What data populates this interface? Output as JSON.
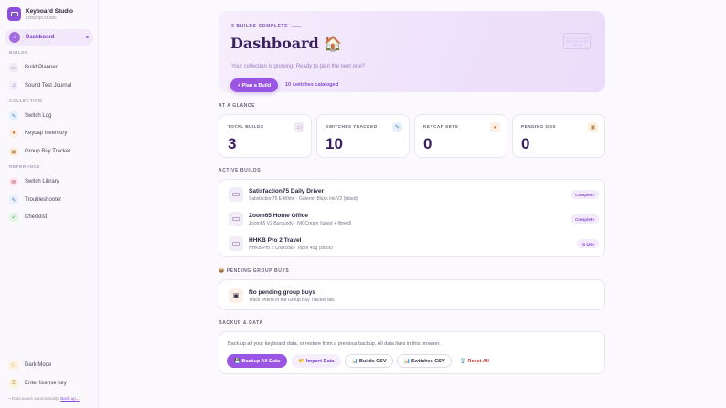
{
  "app": {
    "name": "Keyboard Studio",
    "subtitle": "ccmanpt.studio"
  },
  "sidebar": {
    "active": {
      "label": "Dashboard",
      "icon": "home-icon"
    },
    "sections": {
      "builds": "BUILDS",
      "collection": "COLLECTION",
      "reference": "REFERENCE"
    },
    "items": [
      {
        "label": "Build Planner",
        "icon": "keyboard-icon"
      },
      {
        "label": "Sound Test Journal",
        "icon": "music-icon"
      },
      {
        "label": "Switch Log",
        "icon": "wrench-icon"
      },
      {
        "label": "Keycap Inventory",
        "icon": "palette-icon"
      },
      {
        "label": "Group Buy Tracker",
        "icon": "package-icon"
      },
      {
        "label": "Switch Library",
        "icon": "book-icon"
      },
      {
        "label": "Troubleshooter",
        "icon": "wrench-icon"
      },
      {
        "label": "Checklist",
        "icon": "check-icon"
      }
    ],
    "footer": {
      "dark_mode": "Dark Mode",
      "license": "Enter license key",
      "autosave_text": "Data saves automatically.",
      "autosave_link": "Back up..."
    }
  },
  "hero": {
    "kicker": "3 BUILDS COMPLETE",
    "title": "Dashboard 🏠",
    "subtitle": "Your collection is growing. Ready to plan the next one?",
    "button": "+ Plan a Build",
    "meta": "10 switches cataloged"
  },
  "glance": {
    "heading": "AT A GLANCE",
    "stats": [
      {
        "label": "TOTAL BUILDS",
        "value": "3",
        "icon": "keyboard-icon"
      },
      {
        "label": "SWITCHES TRACKED",
        "value": "10",
        "icon": "wrench-icon"
      },
      {
        "label": "KEYCAP SETS",
        "value": "0",
        "icon": "palette-icon"
      },
      {
        "label": "PENDING GBS",
        "value": "0",
        "icon": "package-icon"
      }
    ]
  },
  "active_builds": {
    "heading": "ACTIVE BUILDS",
    "rows": [
      {
        "name": "Satisfaction75 Daily Driver",
        "detail": "Satisfaction75 E-White · Gateron Black Ink V2 (lubed)",
        "status": "Complete"
      },
      {
        "name": "Zoom65 Home Office",
        "detail": "Zoom65 V2 Burgundy · NK Cream (lubed + filmed)",
        "status": "Complete"
      },
      {
        "name": "HHKB Pro 2 Travel",
        "detail": "HHKB Pro 2 Charcoal · Topre 45g (stock)",
        "status": "In Use"
      }
    ]
  },
  "pending": {
    "heading": "📦 PENDING GROUP BUYS",
    "title": "No pending group buys",
    "subtitle": "Track orders in the Group Buy Tracker tab."
  },
  "backup": {
    "heading": "BACKUP & DATA",
    "text": "Back up all your keyboard data, or restore from a previous backup. All data lives in this browser.",
    "buttons": {
      "backup": "💾 Backup All Data",
      "import": "📂 Import Data",
      "builds_csv": "📊 Builds CSV",
      "switches_csv": "📊 Switches CSV",
      "reset": "🗑️ Reset All"
    }
  }
}
